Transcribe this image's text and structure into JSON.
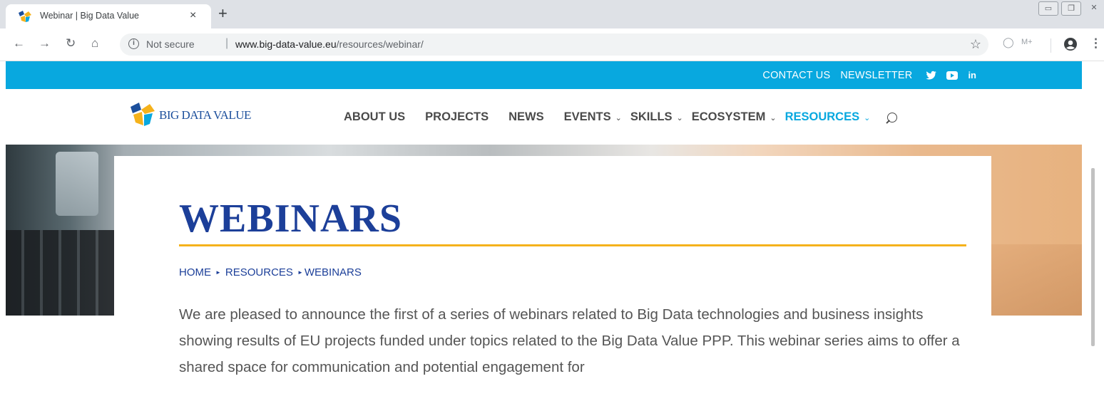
{
  "browser": {
    "tab_title": "Webinar | Big Data Value",
    "tab_close": "×",
    "new_tab": "+",
    "security_label": "Not secure",
    "url_host": "www.big-data-value.eu",
    "url_path": "/resources/webinar/",
    "ext_label": "M+"
  },
  "site": {
    "topbar": {
      "contact": "CONTACT US",
      "newsletter": "NEWSLETTER",
      "linkedin": "in"
    },
    "logo_text": "BIG DATA VALUE",
    "nav": [
      {
        "label": "ABOUT US",
        "dropdown": false
      },
      {
        "label": "PROJECTS",
        "dropdown": false
      },
      {
        "label": "NEWS",
        "dropdown": false
      },
      {
        "label": "EVENTS",
        "dropdown": true
      },
      {
        "label": "SKILLS",
        "dropdown": true
      },
      {
        "label": "ECOSYSTEM",
        "dropdown": true
      },
      {
        "label": "RESOURCES",
        "dropdown": true,
        "active": true
      }
    ],
    "accent_color": "#08a8df",
    "title_color": "#1c3f99",
    "rule_color": "#f5b21b"
  },
  "content": {
    "title": "WEBINARS",
    "breadcrumb": [
      "HOME",
      "RESOURCES",
      "WEBINARS"
    ],
    "intro": "We are pleased to announce the first of a series of webinars related to Big Data technologies and business insights showing results of EU projects funded under topics related to the Big Data Value PPP. This webinar series aims to offer a shared space for communication and potential engagement for"
  }
}
